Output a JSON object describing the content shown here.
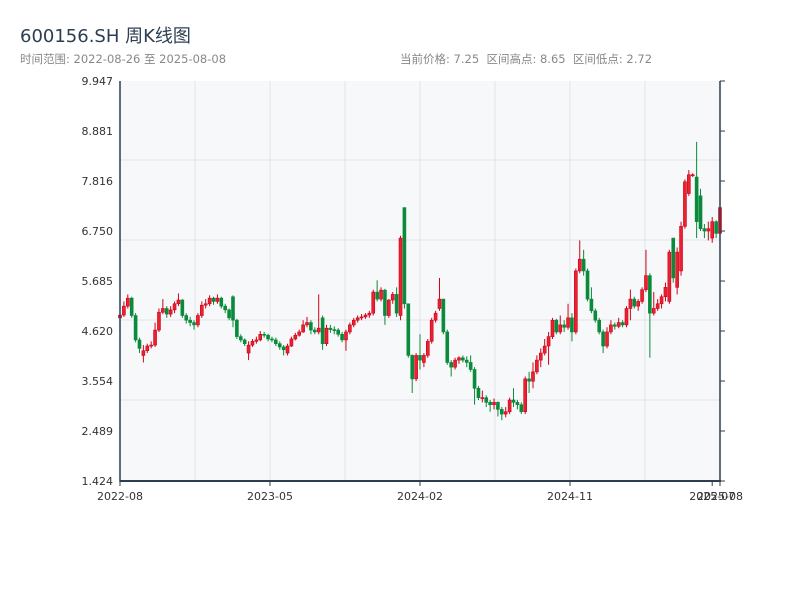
{
  "title": "600156.SH 周K线图",
  "range_label": "时间范围: 2022-08-26 至 2025-08-08",
  "stats_label": "当前价格: 7.25  区间高点: 8.65  区间低点: 2.72",
  "chart_data": {
    "type": "candlestick",
    "title": "600156.SH 周K线图",
    "start_date": "2022-08-26",
    "end_date": "2025-08-08",
    "interval": "weekly",
    "current_price": 7.25,
    "period_high": 8.65,
    "period_low": 2.72,
    "colors": {
      "up": "#d0021b",
      "down": "#0a8a3a"
    },
    "ylim": [
      1.424,
      9.947
    ],
    "y_ticks": [
      "9.947",
      "8.881",
      "7.816",
      "6.750",
      "5.685",
      "4.620",
      "3.554",
      "2.489",
      "1.424"
    ],
    "x_ticks": [
      {
        "label": "2022-08",
        "week": 0
      },
      {
        "label": "2023-05",
        "week": 38.5
      },
      {
        "label": "2024-02",
        "week": 77
      },
      {
        "label": "2024-11",
        "week": 115.5
      },
      {
        "label": "2025-07",
        "week": 152
      },
      {
        "label": "2025-08",
        "week": 154
      }
    ],
    "grid": true,
    "candles_ohlc": [
      [
        4.9,
        5.02,
        4.85,
        4.96
      ],
      [
        4.96,
        5.25,
        4.92,
        5.15
      ],
      [
        5.15,
        5.4,
        5.1,
        5.32
      ],
      [
        5.32,
        5.35,
        4.9,
        4.95
      ],
      [
        4.95,
        5.0,
        4.38,
        4.43
      ],
      [
        4.43,
        4.48,
        4.15,
        4.25
      ],
      [
        4.1,
        4.32,
        3.95,
        4.2
      ],
      [
        4.2,
        4.35,
        4.15,
        4.3
      ],
      [
        4.3,
        4.4,
        4.25,
        4.32
      ],
      [
        4.32,
        4.8,
        4.28,
        4.64
      ],
      [
        4.64,
        5.1,
        4.6,
        5.02
      ],
      [
        5.02,
        5.3,
        4.98,
        5.1
      ],
      [
        5.1,
        5.15,
        4.9,
        4.98
      ],
      [
        4.98,
        5.15,
        4.92,
        5.07
      ],
      [
        5.07,
        5.25,
        5.0,
        5.2
      ],
      [
        5.2,
        5.42,
        5.15,
        5.28
      ],
      [
        5.28,
        5.3,
        4.9,
        4.95
      ],
      [
        4.95,
        5.0,
        4.78,
        4.85
      ],
      [
        4.85,
        4.92,
        4.72,
        4.8
      ],
      [
        4.8,
        4.85,
        4.65,
        4.75
      ],
      [
        4.75,
        5.0,
        4.7,
        4.95
      ],
      [
        4.95,
        5.25,
        4.9,
        5.17
      ],
      [
        5.17,
        5.3,
        5.1,
        5.2
      ],
      [
        5.2,
        5.38,
        5.15,
        5.32
      ],
      [
        5.32,
        5.35,
        5.18,
        5.25
      ],
      [
        5.25,
        5.4,
        5.2,
        5.32
      ],
      [
        5.32,
        5.35,
        5.1,
        5.15
      ],
      [
        5.15,
        5.2,
        5.0,
        5.07
      ],
      [
        5.07,
        5.1,
        4.85,
        4.9
      ],
      [
        5.35,
        5.38,
        4.7,
        4.85
      ],
      [
        4.85,
        4.88,
        4.45,
        4.5
      ],
      [
        4.5,
        4.55,
        4.38,
        4.43
      ],
      [
        4.43,
        4.46,
        4.3,
        4.35
      ],
      [
        4.15,
        4.4,
        4.0,
        4.32
      ],
      [
        4.32,
        4.45,
        4.28,
        4.4
      ],
      [
        4.4,
        4.5,
        4.35,
        4.43
      ],
      [
        4.43,
        4.62,
        4.4,
        4.55
      ],
      [
        4.55,
        4.6,
        4.48,
        4.53
      ],
      [
        4.53,
        4.56,
        4.4,
        4.45
      ],
      [
        4.45,
        4.5,
        4.38,
        4.43
      ],
      [
        4.43,
        4.48,
        4.3,
        4.35
      ],
      [
        4.35,
        4.4,
        4.22,
        4.28
      ],
      [
        4.28,
        4.32,
        4.1,
        4.22
      ],
      [
        4.15,
        4.35,
        4.1,
        4.3
      ],
      [
        4.3,
        4.5,
        4.28,
        4.45
      ],
      [
        4.45,
        4.58,
        4.42,
        4.53
      ],
      [
        4.53,
        4.65,
        4.5,
        4.6
      ],
      [
        4.6,
        4.85,
        4.58,
        4.75
      ],
      [
        4.75,
        4.92,
        4.7,
        4.8
      ],
      [
        4.8,
        4.85,
        4.55,
        4.64
      ],
      [
        4.64,
        4.7,
        4.55,
        4.6
      ],
      [
        4.6,
        5.4,
        4.55,
        4.68
      ],
      [
        4.9,
        4.95,
        4.22,
        4.35
      ],
      [
        4.35,
        4.75,
        4.3,
        4.68
      ],
      [
        4.68,
        4.75,
        4.58,
        4.65
      ],
      [
        4.65,
        4.72,
        4.55,
        4.64
      ],
      [
        4.64,
        4.68,
        4.5,
        4.55
      ],
      [
        4.55,
        4.6,
        4.38,
        4.43
      ],
      [
        4.43,
        4.65,
        4.2,
        4.6
      ],
      [
        4.6,
        4.8,
        4.55,
        4.75
      ],
      [
        4.75,
        4.9,
        4.7,
        4.85
      ],
      [
        4.85,
        4.95,
        4.8,
        4.9
      ],
      [
        4.9,
        4.98,
        4.85,
        4.92
      ],
      [
        4.92,
        5.0,
        4.88,
        4.96
      ],
      [
        4.96,
        5.05,
        4.9,
        5.0
      ],
      [
        5.0,
        5.5,
        4.95,
        5.45
      ],
      [
        5.45,
        5.7,
        5.25,
        5.3
      ],
      [
        5.3,
        5.55,
        5.25,
        5.49
      ],
      [
        5.49,
        5.52,
        4.75,
        4.95
      ],
      [
        4.95,
        5.3,
        4.9,
        5.28
      ],
      [
        5.28,
        5.45,
        5.2,
        5.4
      ],
      [
        5.4,
        5.55,
        4.92,
        5.0
      ],
      [
        4.95,
        6.65,
        4.85,
        6.6
      ],
      [
        7.25,
        7.25,
        5.1,
        5.2
      ],
      [
        5.2,
        5.2,
        4.05,
        4.1
      ],
      [
        4.1,
        4.12,
        3.3,
        3.6
      ],
      [
        3.6,
        4.15,
        3.55,
        4.1
      ],
      [
        4.1,
        4.55,
        3.8,
        4.0
      ],
      [
        3.95,
        4.15,
        3.85,
        4.1
      ],
      [
        4.1,
        4.45,
        4.05,
        4.4
      ],
      [
        4.4,
        4.9,
        4.35,
        4.85
      ],
      [
        4.85,
        5.05,
        4.8,
        5.0
      ],
      [
        5.1,
        5.75,
        5.05,
        5.3
      ],
      [
        5.3,
        5.3,
        4.55,
        4.6
      ],
      [
        4.6,
        4.65,
        3.9,
        3.95
      ],
      [
        3.95,
        4.0,
        3.65,
        3.85
      ],
      [
        3.85,
        4.05,
        3.8,
        4.0
      ],
      [
        4.0,
        4.08,
        3.92,
        4.05
      ],
      [
        4.05,
        4.1,
        3.95,
        4.0
      ],
      [
        4.0,
        4.08,
        3.85,
        3.95
      ],
      [
        3.95,
        4.1,
        3.75,
        3.8
      ],
      [
        3.8,
        3.85,
        3.05,
        3.4
      ],
      [
        3.4,
        3.45,
        3.15,
        3.2
      ],
      [
        3.2,
        3.35,
        3.1,
        3.2
      ],
      [
        3.2,
        3.25,
        3.0,
        3.1
      ],
      [
        3.1,
        3.15,
        2.9,
        3.05
      ],
      [
        3.05,
        3.18,
        2.95,
        3.1
      ],
      [
        3.1,
        3.12,
        2.8,
        2.95
      ],
      [
        2.95,
        3.0,
        2.72,
        2.85
      ],
      [
        2.85,
        3.0,
        2.78,
        2.9
      ],
      [
        2.9,
        3.2,
        2.85,
        3.15
      ],
      [
        3.15,
        3.4,
        3.0,
        3.1
      ],
      [
        3.1,
        3.15,
        2.95,
        3.05
      ],
      [
        3.05,
        3.1,
        2.85,
        2.9
      ],
      [
        2.9,
        3.65,
        2.85,
        3.6
      ],
      [
        3.6,
        3.75,
        3.3,
        3.55
      ],
      [
        3.55,
        3.95,
        3.4,
        3.75
      ],
      [
        3.75,
        4.1,
        3.7,
        4.0
      ],
      [
        4.0,
        4.25,
        3.85,
        4.15
      ],
      [
        4.15,
        4.45,
        4.1,
        4.3
      ],
      [
        4.3,
        4.6,
        3.9,
        4.5
      ],
      [
        4.5,
        4.9,
        4.45,
        4.85
      ],
      [
        4.85,
        4.88,
        4.55,
        4.6
      ],
      [
        4.6,
        4.95,
        4.55,
        4.75
      ],
      [
        4.75,
        4.85,
        4.6,
        4.7
      ],
      [
        4.7,
        5.2,
        4.65,
        4.9
      ],
      [
        4.9,
        5.0,
        4.4,
        4.6
      ],
      [
        4.6,
        5.95,
        4.55,
        5.9
      ],
      [
        5.9,
        6.55,
        5.85,
        6.15
      ],
      [
        6.15,
        6.35,
        5.8,
        5.9
      ],
      [
        5.9,
        5.95,
        5.25,
        5.3
      ],
      [
        5.3,
        5.55,
        5.0,
        5.05
      ],
      [
        5.05,
        5.1,
        4.8,
        4.85
      ],
      [
        4.85,
        4.9,
        4.55,
        4.6
      ],
      [
        4.6,
        4.65,
        4.15,
        4.3
      ],
      [
        4.3,
        4.7,
        4.25,
        4.6
      ],
      [
        4.6,
        4.85,
        4.55,
        4.75
      ],
      [
        4.75,
        4.8,
        4.65,
        4.72
      ],
      [
        4.72,
        4.9,
        4.68,
        4.8
      ],
      [
        4.8,
        4.85,
        4.7,
        4.75
      ],
      [
        4.75,
        5.15,
        4.7,
        5.1
      ],
      [
        5.1,
        5.5,
        4.85,
        5.3
      ],
      [
        5.3,
        5.35,
        5.1,
        5.15
      ],
      [
        5.15,
        5.3,
        5.05,
        5.25
      ],
      [
        5.25,
        5.55,
        5.2,
        5.5
      ],
      [
        5.5,
        6.35,
        5.45,
        5.8
      ],
      [
        5.8,
        5.85,
        4.05,
        5.0
      ],
      [
        5.0,
        5.45,
        4.95,
        5.1
      ],
      [
        5.1,
        5.3,
        5.05,
        5.2
      ],
      [
        5.2,
        5.4,
        5.1,
        5.35
      ],
      [
        5.35,
        5.65,
        5.25,
        5.55
      ],
      [
        5.25,
        6.35,
        5.2,
        6.3
      ],
      [
        6.6,
        6.6,
        5.65,
        5.75
      ],
      [
        5.55,
        6.4,
        5.4,
        6.3
      ],
      [
        5.9,
        6.95,
        5.8,
        6.85
      ],
      [
        6.85,
        7.85,
        6.8,
        7.8
      ],
      [
        7.55,
        8.05,
        7.5,
        7.95
      ],
      [
        7.95,
        7.98,
        7.9,
        7.95
      ],
      [
        7.9,
        8.65,
        6.6,
        6.95
      ],
      [
        7.5,
        7.65,
        6.75,
        6.8
      ],
      [
        6.8,
        6.9,
        6.6,
        6.75
      ],
      [
        6.75,
        6.95,
        6.55,
        6.8
      ],
      [
        6.6,
        7.05,
        6.5,
        6.95
      ],
      [
        6.95,
        6.98,
        6.6,
        6.7
      ],
      [
        6.7,
        7.4,
        6.55,
        7.25
      ]
    ]
  }
}
